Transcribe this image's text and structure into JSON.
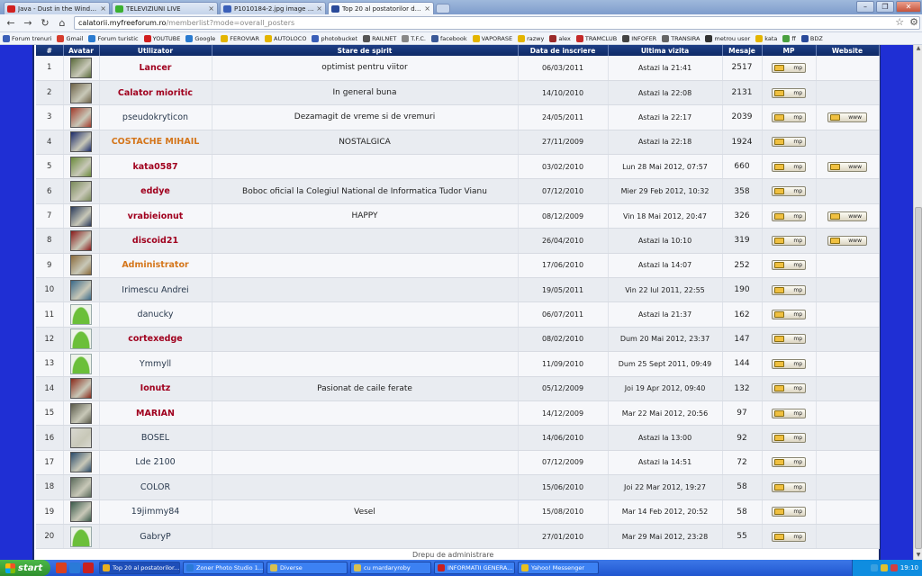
{
  "browser": {
    "tabs": [
      {
        "label": "Java - Dust in the Wind Live - ",
        "icon": "youtube-icon",
        "color": "#d12020"
      },
      {
        "label": "TELEVIZIUNI LIVE",
        "icon": "chat-bubble-icon",
        "color": "#3bb030"
      },
      {
        "label": "P1010184-2.jpg image by mih",
        "icon": "photobucket-icon",
        "color": "#3a5fb8"
      },
      {
        "label": "Top 20 al postatorilor din forum",
        "icon": "forum-icon",
        "color": "#2a4a9a",
        "active": true
      }
    ],
    "url_host": "calatorii.myfreeforum.ro",
    "url_path": "/memberlist?mode=overall_posters",
    "bookmarks": [
      {
        "label": "Forum trenuri",
        "icon": "folder-icon",
        "color": "#3a5fb8"
      },
      {
        "label": "Gmail",
        "icon": "gmail-icon",
        "color": "#d63d2e"
      },
      {
        "label": "Forum turistic",
        "icon": "globe-icon",
        "color": "#2a7bd0"
      },
      {
        "label": "YOUTUBE",
        "icon": "youtube-icon",
        "color": "#d12020"
      },
      {
        "label": "Google",
        "icon": "google-icon",
        "color": "#2a7bd0"
      },
      {
        "label": "FEROVIAR",
        "icon": "chat-bubble-icon",
        "color": "#e4b500"
      },
      {
        "label": "AUTOLOCO",
        "icon": "chat-bubble-icon",
        "color": "#e4b500"
      },
      {
        "label": "photobucket",
        "icon": "photobucket-icon",
        "color": "#3a5fb8"
      },
      {
        "label": "RAILNET",
        "icon": "railnet-icon",
        "color": "#555555"
      },
      {
        "label": "T.F.C.",
        "icon": "tfc-icon",
        "color": "#888888"
      },
      {
        "label": "facebook",
        "icon": "facebook-icon",
        "color": "#3b5998"
      },
      {
        "label": "VAPORASE",
        "icon": "chat-bubble-icon",
        "color": "#e4b500"
      },
      {
        "label": "razwy",
        "icon": "chat-bubble-icon",
        "color": "#e4b500"
      },
      {
        "label": "alex",
        "icon": "alex-icon",
        "color": "#9a2a2a"
      },
      {
        "label": "TRAMCLUB",
        "icon": "tram-icon",
        "color": "#c42a2a"
      },
      {
        "label": "INFOFER",
        "icon": "infofer-icon",
        "color": "#444444"
      },
      {
        "label": "TRANSIRA",
        "icon": "transira-icon",
        "color": "#666666"
      },
      {
        "label": "metrou usor",
        "icon": "metro-icon",
        "color": "#333333"
      },
      {
        "label": "kata",
        "icon": "chat-bubble-icon",
        "color": "#e4b500"
      },
      {
        "label": "ff",
        "icon": "ff-icon",
        "color": "#4aa040"
      },
      {
        "label": "BDZ",
        "icon": "bdz-icon",
        "color": "#2a4a9a"
      }
    ]
  },
  "forum": {
    "headers": [
      "#",
      "Avatar",
      "Utilizator",
      "Stare de spirit",
      "Data de inscriere",
      "Ultima vizita",
      "Mesaje",
      "MP",
      "Website"
    ],
    "pm_label": "mp",
    "www_label": "www",
    "rows": [
      {
        "rank": "1",
        "user": "Lancer",
        "style": "red",
        "status": "optimist pentru viitor",
        "joined": "06/03/2011",
        "last_visit": "Astazi la 21:41",
        "posts": "2517",
        "www": false,
        "avatar": "#5a6a3a"
      },
      {
        "rank": "2",
        "user": "Calator mioritic",
        "style": "red",
        "status": "In general buna",
        "joined": "14/10/2010",
        "last_visit": "Astazi la 22:08",
        "posts": "2131",
        "www": false,
        "avatar": "#6d6248"
      },
      {
        "rank": "3",
        "user": "pseudokryticon",
        "style": "plain",
        "status": "Dezamagit de vreme si de vremuri",
        "joined": "24/05/2011",
        "last_visit": "Astazi la 22:17",
        "posts": "2039",
        "www": true,
        "avatar": "#a33a2a"
      },
      {
        "rank": "4",
        "user": "COSTACHE MIHAIL",
        "style": "orange",
        "status": "NOSTALGICA",
        "joined": "27/11/2009",
        "last_visit": "Astazi la 22:18",
        "posts": "1924",
        "www": false,
        "avatar": "#1a2a6a"
      },
      {
        "rank": "5",
        "user": "kata0587",
        "style": "red",
        "status": "",
        "joined": "03/02/2010",
        "last_visit": "Lun 28 Mai 2012, 07:57",
        "posts": "660",
        "www": true,
        "avatar": "#6a8a3a"
      },
      {
        "rank": "6",
        "user": "eddye",
        "style": "red",
        "status": "Boboc oficial la Colegiul National de Informatica Tudor Vianu",
        "joined": "07/12/2010",
        "last_visit": "Mier 29 Feb 2012, 10:32",
        "posts": "358",
        "www": false,
        "avatar": "#7a8a5a"
      },
      {
        "rank": "7",
        "user": "vrabieionut",
        "style": "red",
        "status": "HAPPY",
        "joined": "08/12/2009",
        "last_visit": "Vin 18 Mai 2012, 20:47",
        "posts": "326",
        "www": true,
        "avatar": "#2a3a5a"
      },
      {
        "rank": "8",
        "user": "discoid21",
        "style": "red",
        "status": "",
        "joined": "26/04/2010",
        "last_visit": "Astazi la 10:10",
        "posts": "319",
        "www": true,
        "avatar": "#8a1a1a"
      },
      {
        "rank": "9",
        "user": "Administrator",
        "style": "orange",
        "status": "",
        "joined": "17/06/2010",
        "last_visit": "Astazi la 14:07",
        "posts": "252",
        "www": false,
        "avatar": "#8a6a3a"
      },
      {
        "rank": "10",
        "user": "Irimescu Andrei",
        "style": "plain",
        "status": "",
        "joined": "19/05/2011",
        "last_visit": "Vin 22 Iul 2011, 22:55",
        "posts": "190",
        "www": false,
        "avatar": "#3a6a8a"
      },
      {
        "rank": "11",
        "user": "danucky",
        "style": "plain",
        "status": "",
        "joined": "06/07/2011",
        "last_visit": "Astazi la 21:37",
        "posts": "162",
        "www": false,
        "avatar": "default"
      },
      {
        "rank": "12",
        "user": "cortexedge",
        "style": "red",
        "status": "",
        "joined": "08/02/2010",
        "last_visit": "Dum 20 Mai 2012, 23:37",
        "posts": "147",
        "www": false,
        "avatar": "default"
      },
      {
        "rank": "13",
        "user": "Ymmyll",
        "style": "plain",
        "status": "",
        "joined": "11/09/2010",
        "last_visit": "Dum 25 Sept 2011, 09:49",
        "posts": "144",
        "www": false,
        "avatar": "default"
      },
      {
        "rank": "14",
        "user": "Ionutz",
        "style": "red",
        "status": "Pasionat de caile ferate",
        "joined": "05/12/2009",
        "last_visit": "Joi 19 Apr 2012, 09:40",
        "posts": "132",
        "www": false,
        "avatar": "#8a2a1a"
      },
      {
        "rank": "15",
        "user": "MARIAN",
        "style": "red",
        "status": "",
        "joined": "14/12/2009",
        "last_visit": "Mar 22 Mai 2012, 20:56",
        "posts": "97",
        "www": false,
        "avatar": "#5a5a4a"
      },
      {
        "rank": "16",
        "user": "BOSEL",
        "style": "plain",
        "status": "",
        "joined": "14/06/2010",
        "last_visit": "Astazi la 13:00",
        "posts": "92",
        "www": false,
        "avatar": "#d8d8d0"
      },
      {
        "rank": "17",
        "user": "Lde 2100",
        "style": "plain",
        "status": "",
        "joined": "07/12/2009",
        "last_visit": "Astazi la 14:51",
        "posts": "72",
        "www": false,
        "avatar": "#2a4a6a"
      },
      {
        "rank": "18",
        "user": "COLOR",
        "style": "plain",
        "status": "",
        "joined": "15/06/2010",
        "last_visit": "Joi 22 Mar 2012, 19:27",
        "posts": "58",
        "www": false,
        "avatar": "#5a6a5a"
      },
      {
        "rank": "19",
        "user": "19jimmy84",
        "style": "plain",
        "status": "Vesel",
        "joined": "15/08/2010",
        "last_visit": "Mar 14 Feb 2012, 20:52",
        "posts": "58",
        "www": false,
        "avatar": "#3a5a4a"
      },
      {
        "rank": "20",
        "user": "GabryP",
        "style": "plain",
        "status": "",
        "joined": "27/01/2010",
        "last_visit": "Mar 29 Mai 2012, 23:28",
        "posts": "55",
        "www": false,
        "avatar": "default"
      }
    ],
    "footer_text": "Drepu de administrare"
  },
  "taskbar": {
    "start_label": "start",
    "tasks": [
      {
        "label": "Top 20 al postatorilor...",
        "icon": "chrome-icon",
        "color": "#e8b020",
        "active": true
      },
      {
        "label": "Zoner Photo Studio 1...",
        "icon": "zoner-icon",
        "color": "#2a7ad8"
      },
      {
        "label": "Diverse",
        "icon": "folder-icon",
        "color": "#d8c050"
      },
      {
        "label": "cu mardaryroby",
        "icon": "folder-icon",
        "color": "#d8c050"
      },
      {
        "label": "INFORMATII GENERA...",
        "icon": "opera-icon",
        "color": "#c82020"
      },
      {
        "label": "Yahoo! Messenger",
        "icon": "yahoo-icon",
        "color": "#e8c020"
      }
    ],
    "clock": "19:10"
  }
}
